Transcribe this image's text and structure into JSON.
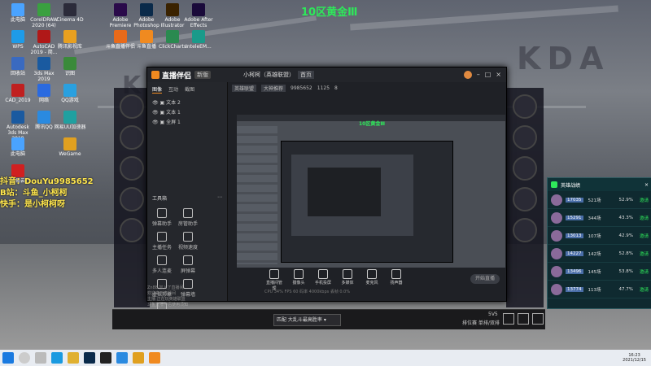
{
  "rank_title": "10区黄金Ⅲ",
  "overlay": {
    "line1": "抖音：DouYu9985652",
    "line2": "B站：斗鱼_小柯柯",
    "line3": "快手：是小柯柯呀"
  },
  "desktop_icons": [
    {
      "label": "此电脑",
      "color": "#4aa3ff"
    },
    {
      "label": "WPS",
      "color": "#1e9be8"
    },
    {
      "label": "Cinema 4D",
      "color": "#2b2b3a"
    },
    {
      "label": "Adobe Premiere",
      "color": "#2a0a4a"
    },
    {
      "label": "Adobe Photoshop",
      "color": "#0a2a4a"
    },
    {
      "label": "Adobe Illustrator",
      "color": "#3a2200"
    },
    {
      "label": "Adobe After Effects",
      "color": "#1a0a3a"
    },
    {
      "label": "回收站",
      "color": "#3a6ac0"
    },
    {
      "label": "CorelDRAW 2020 (64)",
      "color": "#3aa040"
    },
    {
      "label": "腾讯影视库",
      "color": "#e8a020"
    },
    {
      "label": "斗鱼直播伴侣",
      "color": "#e86a1a"
    },
    {
      "label": "斗鱼直播",
      "color": "#f08a20"
    },
    {
      "label": "ClickCharts",
      "color": "#2a8a50"
    },
    {
      "label": "InteleEM...",
      "color": "#1a9a8a"
    },
    {
      "label": "CAD_2019",
      "color": "#c02020"
    },
    {
      "label": "AutoCAD 2019 - 简...",
      "color": "#b01818"
    },
    {
      "label": "识图",
      "color": "#3a8a3a"
    },
    {
      "label": "Autodesk 3ds Max 2019",
      "color": "#1a5aa0"
    },
    {
      "label": "3ds Max 2019",
      "color": "#1a5aa0"
    },
    {
      "label": "QQ游戏",
      "color": "#2aa0e0"
    },
    {
      "label": "此电脑",
      "color": "#4aa3ff"
    },
    {
      "label": "网络",
      "color": "#2a6ae0"
    },
    {
      "label": "网易UU加速器",
      "color": "#20a0a0"
    },
    {
      "label": "网易云",
      "color": "#d02020"
    },
    {
      "label": "腾讯QQ",
      "color": "#2a8ae0"
    },
    {
      "label": "WeGame",
      "color": "#e0a020"
    }
  ],
  "app": {
    "brand": "直播伴侣",
    "brand_badge": "新版",
    "left_tabs": [
      "图像",
      "互动",
      "截图"
    ],
    "sources": [
      "文本 2",
      "文本 1",
      "全屏 1"
    ],
    "tools_title": "工具箱",
    "tools": [
      {
        "label": "弹幕助手"
      },
      {
        "label": "房管助手"
      },
      {
        "label": "主播任务"
      },
      {
        "label": "视频速度"
      },
      {
        "label": "多人连麦"
      },
      {
        "label": "屏弹幕"
      },
      {
        "label": "虚拟形象"
      },
      {
        "label": "弹幕墙"
      },
      {
        "label": "歌词显示"
      }
    ],
    "stream_title": "小柯柯（英雄联盟）",
    "stream_badge": "首页",
    "stream_category": "英雄联盟",
    "stream_subcategory": "大神推荐",
    "room_id": "9985652",
    "fans": "1125",
    "hot": "8",
    "bottom_tools": [
      {
        "label": "直播间管理"
      },
      {
        "label": "摄像头"
      },
      {
        "label": "手机投屏"
      },
      {
        "label": "多媒体"
      },
      {
        "label": "麦克风"
      },
      {
        "label": "扬声器"
      }
    ],
    "start_button": "开始直播",
    "status_line": "CPU 34%   FPS 60   码率 4000kbps   丢帧 0.0%",
    "chat_lines": [
      "Zn88 加入了直播间",
      "欢迎来到直播间",
      "主播 正在玩英雄联盟"
    ],
    "chat_notice": "斗鱼直播伴侣使用须知"
  },
  "rank_panel": {
    "title": "英雄战绩",
    "rows": [
      {
        "score": "17035",
        "games": "521场",
        "rate": "52.9%",
        "action": "邀请"
      },
      {
        "score": "15291",
        "games": "344场",
        "rate": "43.3%",
        "action": "邀请"
      },
      {
        "score": "13013",
        "games": "107场",
        "rate": "42.9%",
        "action": "邀请"
      },
      {
        "score": "14227",
        "games": "142场",
        "rate": "52.8%",
        "action": "邀请"
      },
      {
        "score": "13496",
        "games": "145场",
        "rate": "53.8%",
        "action": "邀请"
      },
      {
        "score": "13774",
        "games": "113场",
        "rate": "47.7%",
        "action": "邀请"
      }
    ]
  },
  "game_bar": {
    "mode": "匹配 大乱斗最高胜率",
    "queue_label": "排位赛 单排/双排",
    "vs": "5V5"
  },
  "taskbar": {
    "time": "16:23",
    "date": "2021/12/15"
  }
}
